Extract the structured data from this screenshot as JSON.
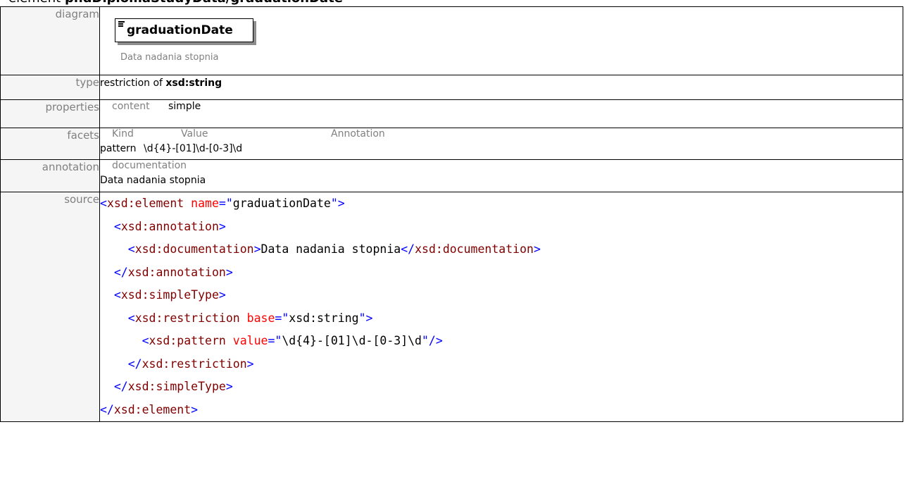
{
  "header": {
    "prefix": "element ",
    "path": "phdDiplomaStudyData/graduationDate"
  },
  "diagram": {
    "label": "diagram",
    "node_name": "graduationDate",
    "node_icon": "element-lines-icon",
    "caption": "Data nadania stopnia"
  },
  "type": {
    "label": "type",
    "prefix": "restriction of ",
    "base": "xsd:string"
  },
  "properties": {
    "label": "properties",
    "key": "content",
    "value": "simple"
  },
  "facets": {
    "label": "facets",
    "headers": [
      "Kind",
      "Value",
      "Annotation"
    ],
    "rows": [
      {
        "kind": "pattern",
        "value": "\\d{4}-[01]\\d-[0-3]\\d",
        "annotation": ""
      }
    ]
  },
  "annotation": {
    "label": "annotation",
    "header": "documentation",
    "text": "Data nadania stopnia"
  },
  "source": {
    "label": "source",
    "colors": {
      "tag": "#800000",
      "punctuation": "#0000ff",
      "attribute": "#ff0000",
      "value": "#000000"
    },
    "lines": [
      [
        {
          "t": "punc",
          "s": "<"
        },
        {
          "t": "tag",
          "s": "xsd:element"
        },
        {
          "t": "text",
          "s": " "
        },
        {
          "t": "attr",
          "s": "name"
        },
        {
          "t": "punc",
          "s": "=\""
        },
        {
          "t": "val",
          "s": "graduationDate"
        },
        {
          "t": "punc",
          "s": "\">"
        }
      ],
      [
        {
          "t": "text",
          "s": "  "
        },
        {
          "t": "punc",
          "s": "<"
        },
        {
          "t": "tag",
          "s": "xsd:annotation"
        },
        {
          "t": "punc",
          "s": ">"
        }
      ],
      [
        {
          "t": "text",
          "s": "    "
        },
        {
          "t": "punc",
          "s": "<"
        },
        {
          "t": "tag",
          "s": "xsd:documentation"
        },
        {
          "t": "punc",
          "s": ">"
        },
        {
          "t": "text",
          "s": "Data nadania stopnia"
        },
        {
          "t": "punc",
          "s": "</"
        },
        {
          "t": "tag",
          "s": "xsd:documentation"
        },
        {
          "t": "punc",
          "s": ">"
        }
      ],
      [
        {
          "t": "text",
          "s": "  "
        },
        {
          "t": "punc",
          "s": "</"
        },
        {
          "t": "tag",
          "s": "xsd:annotation"
        },
        {
          "t": "punc",
          "s": ">"
        }
      ],
      [
        {
          "t": "text",
          "s": "  "
        },
        {
          "t": "punc",
          "s": "<"
        },
        {
          "t": "tag",
          "s": "xsd:simpleType"
        },
        {
          "t": "punc",
          "s": ">"
        }
      ],
      [
        {
          "t": "text",
          "s": "    "
        },
        {
          "t": "punc",
          "s": "<"
        },
        {
          "t": "tag",
          "s": "xsd:restriction"
        },
        {
          "t": "text",
          "s": " "
        },
        {
          "t": "attr",
          "s": "base"
        },
        {
          "t": "punc",
          "s": "=\""
        },
        {
          "t": "val",
          "s": "xsd:string"
        },
        {
          "t": "punc",
          "s": "\">"
        }
      ],
      [
        {
          "t": "text",
          "s": "      "
        },
        {
          "t": "punc",
          "s": "<"
        },
        {
          "t": "tag",
          "s": "xsd:pattern"
        },
        {
          "t": "text",
          "s": " "
        },
        {
          "t": "attr",
          "s": "value"
        },
        {
          "t": "punc",
          "s": "=\""
        },
        {
          "t": "val",
          "s": "\\d{4}-[01]\\d-[0-3]\\d"
        },
        {
          "t": "punc",
          "s": "\"/>"
        }
      ],
      [
        {
          "t": "text",
          "s": "    "
        },
        {
          "t": "punc",
          "s": "</"
        },
        {
          "t": "tag",
          "s": "xsd:restriction"
        },
        {
          "t": "punc",
          "s": ">"
        }
      ],
      [
        {
          "t": "text",
          "s": "  "
        },
        {
          "t": "punc",
          "s": "</"
        },
        {
          "t": "tag",
          "s": "xsd:simpleType"
        },
        {
          "t": "punc",
          "s": ">"
        }
      ],
      [
        {
          "t": "punc",
          "s": "</"
        },
        {
          "t": "tag",
          "s": "xsd:element"
        },
        {
          "t": "punc",
          "s": ">"
        }
      ]
    ]
  }
}
